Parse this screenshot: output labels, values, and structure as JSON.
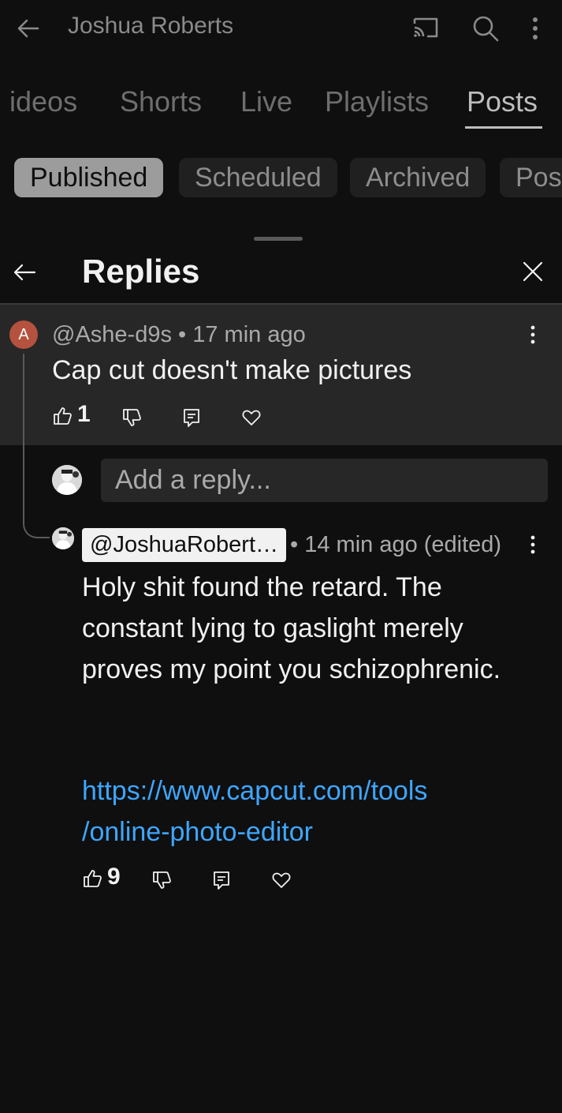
{
  "topbar": {
    "title": "Joshua Roberts",
    "icons": [
      "back-arrow-icon",
      "cast-icon",
      "search-icon",
      "more-vert-icon"
    ]
  },
  "tabs": [
    {
      "label": "Videos",
      "visible_text": "ideos",
      "active": false
    },
    {
      "label": "Shorts",
      "active": false
    },
    {
      "label": "Live",
      "active": false
    },
    {
      "label": "Playlists",
      "active": false
    },
    {
      "label": "Posts",
      "active": true
    }
  ],
  "chips": [
    {
      "label": "Published",
      "selected": true
    },
    {
      "label": "Scheduled",
      "selected": false
    },
    {
      "label": "Archived",
      "selected": false
    },
    {
      "label": "Pos",
      "selected": false
    }
  ],
  "sheet": {
    "title": "Replies"
  },
  "parent_comment": {
    "avatar_letter": "A",
    "author": "@Ashe-d9s",
    "separator": "•",
    "time": "17 min ago",
    "text": "Cap cut doesn't make pictures",
    "like_count": "1"
  },
  "reply_input": {
    "placeholder": "Add a reply..."
  },
  "reply": {
    "author": "@JoshuaRobert…",
    "separator": "•",
    "time": "14 min ago (edited)",
    "text": "Holy shit found the retard. The constant lying to gaslight merely proves my point you schizophrenic.",
    "link": "https://www.capcut.com/tools/online-photo-editor",
    "link_line1": "https://www.capcut.com/tools",
    "link_line2": "/online-photo-editor",
    "like_count": "9"
  },
  "colors": {
    "background": "#0f0f0f",
    "highlight": "#272727",
    "link": "#3ea6ff",
    "avatar_a": "#b4523f"
  }
}
